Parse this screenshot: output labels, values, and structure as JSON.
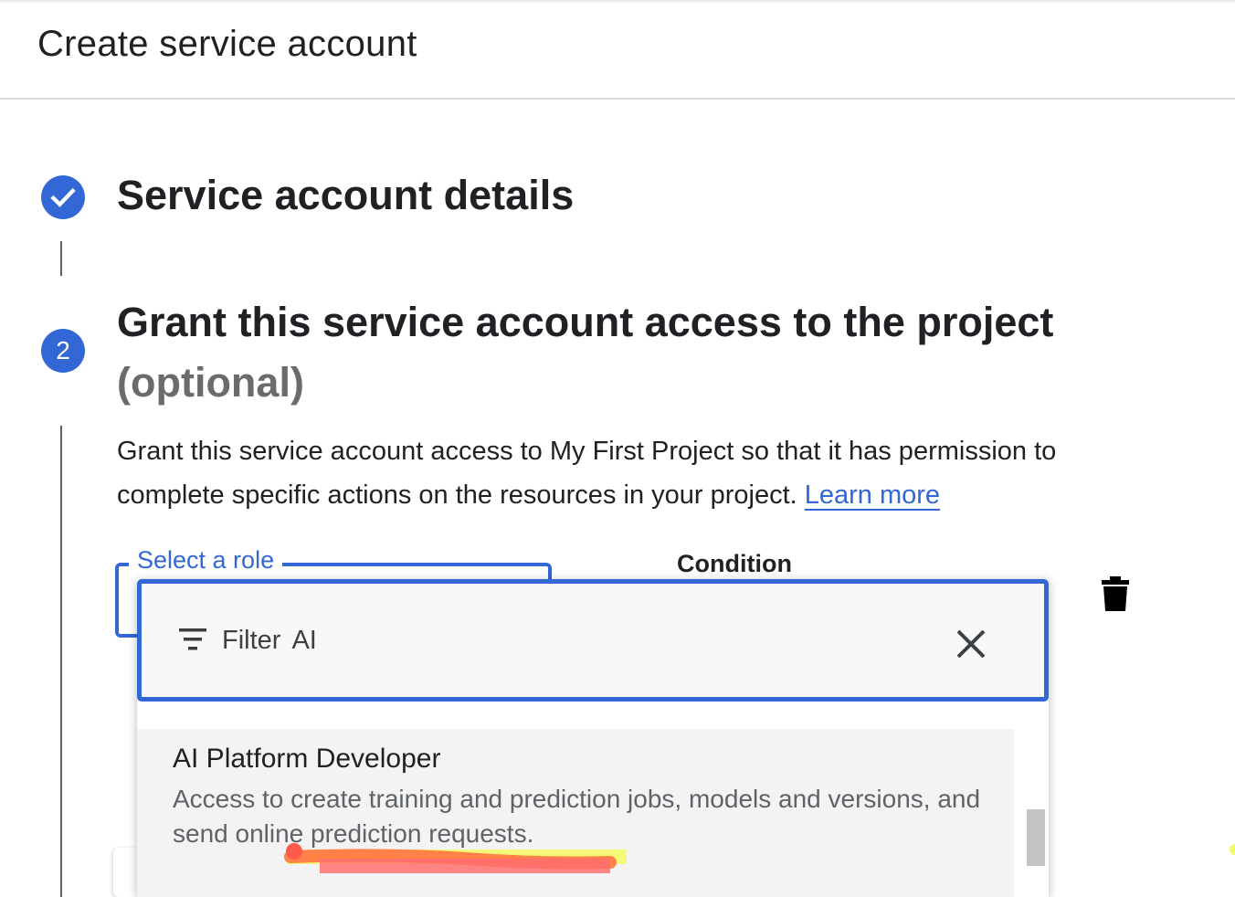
{
  "header": {
    "title": "Create service account"
  },
  "steps": [
    {
      "state": "done",
      "icon": "check-icon",
      "title": "Service account details"
    },
    {
      "state": "active",
      "number": "2",
      "title": "Grant this service account access to the project",
      "subtitle": "(optional)"
    }
  ],
  "grant": {
    "description": "Grant this service account access to My First Project so that it has permission to complete specific actions on the resources in your project.",
    "learn_more": "Learn more"
  },
  "role_select": {
    "label": "Select a role"
  },
  "condition": {
    "label": "Condition"
  },
  "dropdown": {
    "filter_label": "Filter",
    "filter_value": "AI",
    "options": [
      {
        "title": "AI Platform Developer",
        "description": "Access to create training and prediction jobs, models and versions, and send online prediction requests."
      }
    ]
  },
  "colors": {
    "accent": "#3367d6",
    "highlight_yellow": "#f4f96a",
    "highlight_orange": "#ff7a45"
  },
  "icons": {
    "delete": "trash-icon",
    "filter": "filter-icon",
    "close": "close-icon"
  }
}
